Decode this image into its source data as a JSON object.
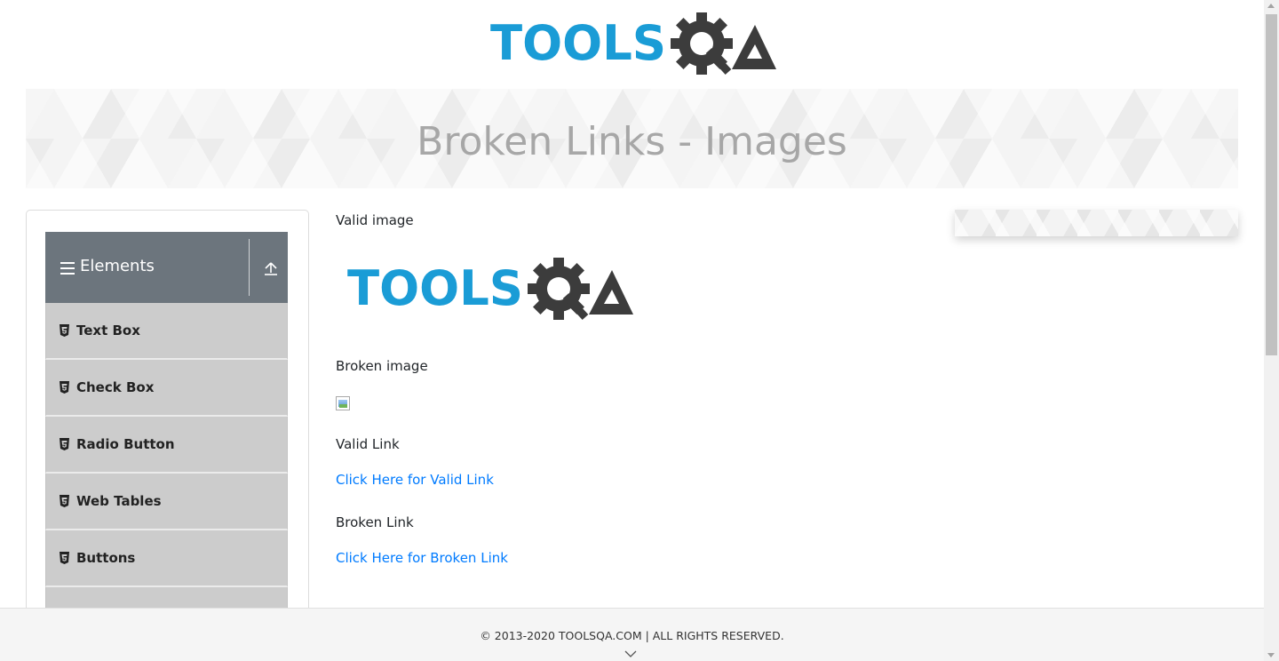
{
  "header": {
    "logo_text_blue": "TOOLS",
    "logo_text_dark": "QA"
  },
  "banner": {
    "title": "Broken Links - Images"
  },
  "sidebar": {
    "group_title": "Elements",
    "items": [
      {
        "label": "Text Box"
      },
      {
        "label": "Check Box"
      },
      {
        "label": "Radio Button"
      },
      {
        "label": "Web Tables"
      },
      {
        "label": "Buttons"
      }
    ]
  },
  "main": {
    "valid_image_label": "Valid image",
    "broken_image_label": "Broken image",
    "valid_link_label": "Valid Link",
    "valid_link_text": "Click Here for Valid Link",
    "broken_link_label": "Broken Link",
    "broken_link_text": "Click Here for Broken Link"
  },
  "footer": {
    "copyright": "© 2013-2020 TOOLSQA.COM | ALL RIGHTS RESERVED."
  },
  "colors": {
    "brand_blue": "#1a9cd6",
    "brand_dark": "#3c3c3c",
    "header_gray": "#6c757d",
    "link": "#007bff"
  }
}
